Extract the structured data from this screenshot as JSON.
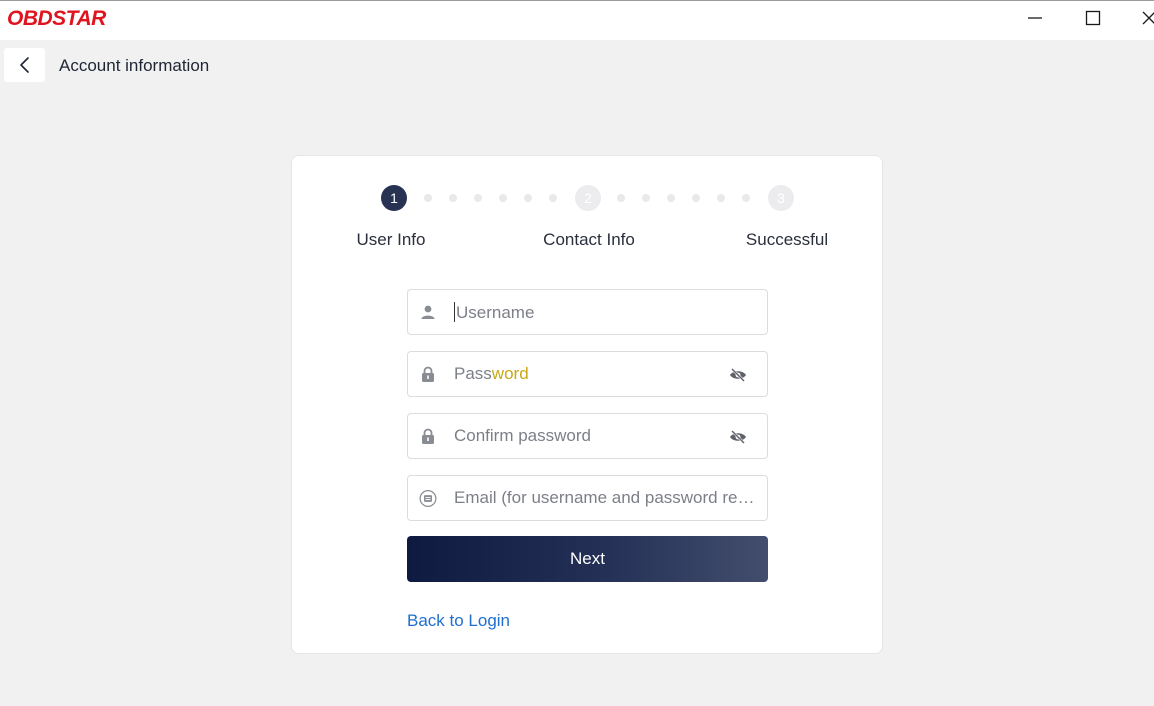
{
  "app": {
    "brand": "OBDSTAR",
    "brand_color": "#e0141e"
  },
  "window_controls": {
    "minimize_icon": "minimize-icon",
    "maximize_icon": "maximize-icon",
    "close_icon": "close-icon"
  },
  "header": {
    "back_icon": "chevron-left-icon",
    "title": "Account information"
  },
  "steps": [
    {
      "number": "1",
      "label": "User Info",
      "state": "active"
    },
    {
      "number": "2",
      "label": "Contact Info",
      "state": "inactive"
    },
    {
      "number": "3",
      "label": "Successful",
      "state": "inactive"
    }
  ],
  "form": {
    "username": {
      "placeholder": "Username",
      "icon": "user-icon"
    },
    "password": {
      "placeholder_start": "Pass",
      "placeholder_highlight": "word",
      "icon": "lock-icon",
      "toggle_icon": "eye-off-icon"
    },
    "confirm_password": {
      "placeholder": "Confirm password",
      "icon": "lock-icon",
      "toggle_icon": "eye-off-icon"
    },
    "email": {
      "placeholder": "Email (for username and password recovery)",
      "icon": "email-icon"
    },
    "next_label": "Next",
    "back_to_login": "Back to Login"
  },
  "colors": {
    "accent_dark": "#283353",
    "link": "#1f6fd0"
  }
}
